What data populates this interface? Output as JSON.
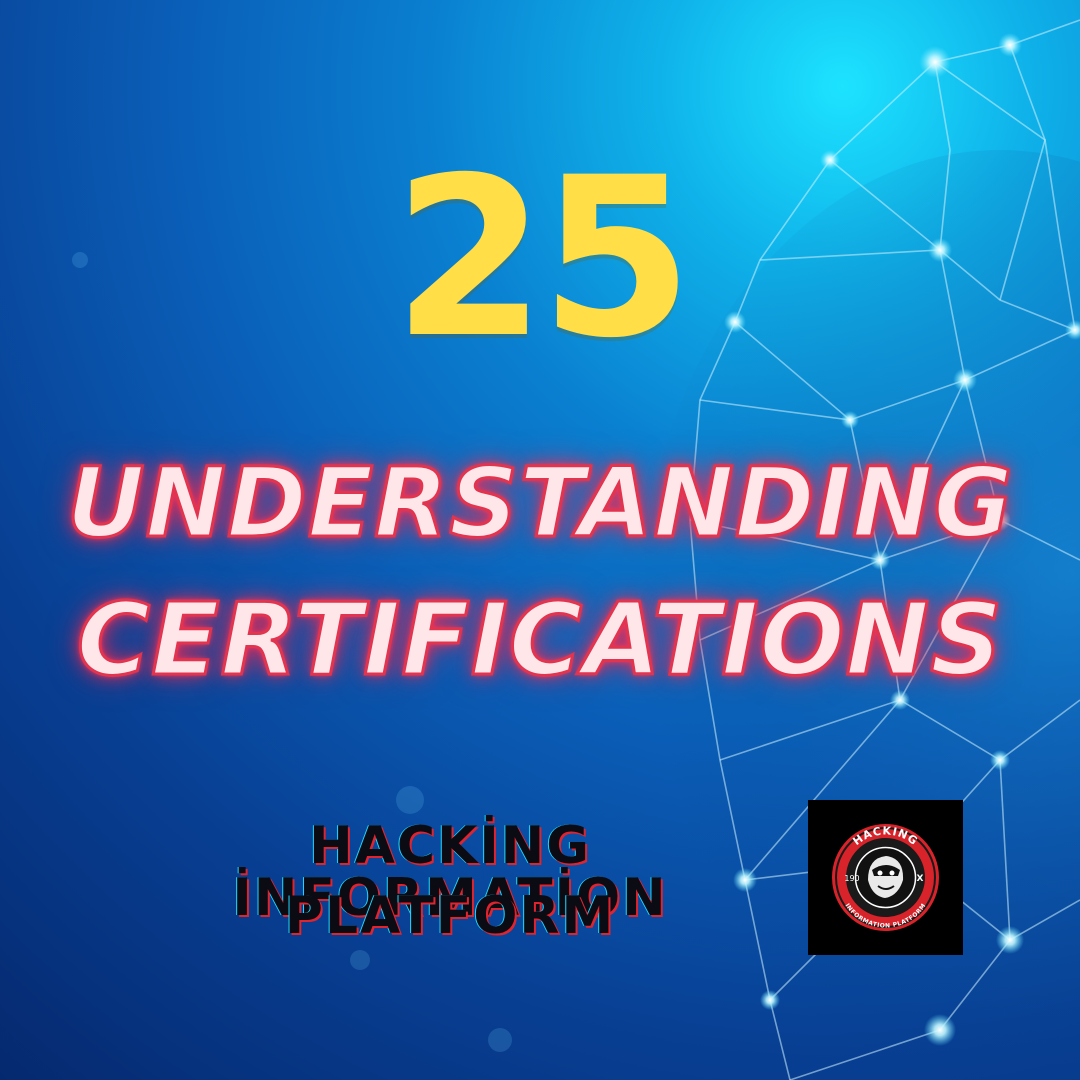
{
  "headline": {
    "number": "25",
    "title_line1": "UNDERSTANDING",
    "title_line2": "CERTIFICATIONS"
  },
  "brand": {
    "name_line1": "HACKİNG İNFORMATİON",
    "name_line2": "PLATFORM",
    "logo": {
      "top_text": "HACKING",
      "bottom_text": "INFORMATION PLATFORM",
      "left_text": "190",
      "right_text": "X"
    }
  },
  "colors": {
    "number": "#ffde47",
    "title_fill": "#ffe6e9",
    "title_glow": "#e2334f",
    "platform_text": "#0b0b14",
    "logo_ring": "#d8232a",
    "logo_bg": "#000000"
  },
  "icons": {
    "background": "globe-network-icon",
    "logo": "hacker-mascot-icon"
  }
}
